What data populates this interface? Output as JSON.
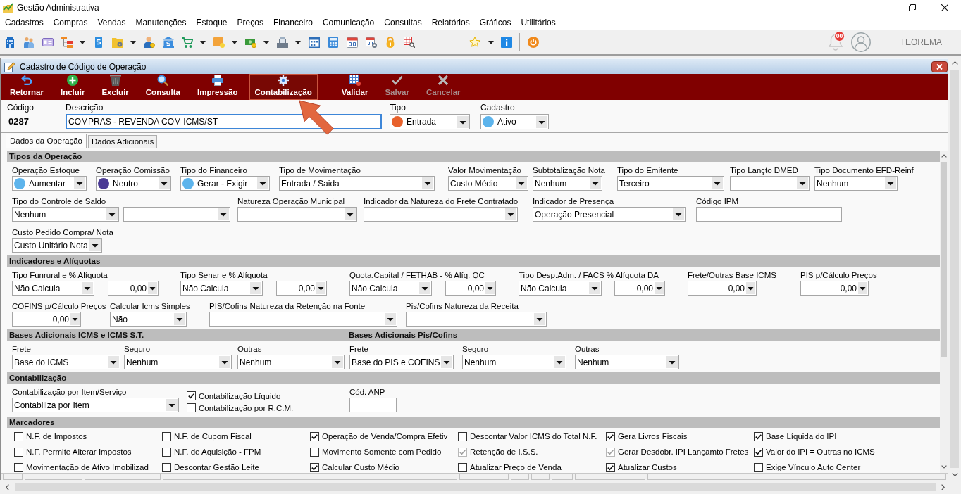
{
  "window": {
    "title": "Gestão Administrativa"
  },
  "menu": [
    "Cadastros",
    "Compras",
    "Vendas",
    "Manutenções",
    "Estoque",
    "Preços",
    "Financeiro",
    "Comunicação",
    "Consultas",
    "Relatórios",
    "Gráficos",
    "Utilitários"
  ],
  "toolbar": {
    "notification_count": "00",
    "user_name": "TEOREMA"
  },
  "child_window": {
    "title": "Cadastro de Código de Operação",
    "actions": [
      {
        "label": "Retornar",
        "highlighted": false,
        "disabled": false
      },
      {
        "label": "Incluir",
        "highlighted": false,
        "disabled": false
      },
      {
        "label": "Excluir",
        "highlighted": false,
        "disabled": false
      },
      {
        "label": "Consulta",
        "highlighted": false,
        "disabled": false
      },
      {
        "label": "Impressão",
        "highlighted": false,
        "disabled": false
      },
      {
        "label": "Contabilização",
        "highlighted": true,
        "disabled": false
      },
      {
        "label": "Validar",
        "highlighted": false,
        "disabled": false
      },
      {
        "label": "Salvar",
        "highlighted": false,
        "disabled": true
      },
      {
        "label": "Cancelar",
        "highlighted": false,
        "disabled": true
      }
    ],
    "header_fields": [
      {
        "label": "Código",
        "kind": "static",
        "value": "0287",
        "focused": false
      },
      {
        "label": "Descrição",
        "kind": "input",
        "value": "COMPRAS - REVENDA COM ICMS/ST",
        "focused": true
      },
      {
        "label": "Tipo",
        "kind": "select",
        "value": "Entrada",
        "color": "#e8622c",
        "focused": false
      },
      {
        "label": "Cadastro",
        "kind": "select",
        "value": "Ativo",
        "color": "#5db4ec",
        "focused": false
      }
    ],
    "tabs": [
      {
        "label": "Dados da Operação",
        "selected": true
      },
      {
        "label": "Dados Adicionais",
        "selected": false
      }
    ],
    "sections": [
      {
        "titles": [
          "Tipos da Operação"
        ],
        "rows": [
          {
            "fields": [
              {
                "label": "Operação Estoque",
                "kind": "select",
                "value": "Aumentar",
                "color": "#5db4ec"
              },
              {
                "label": "Operação Comissão",
                "kind": "select",
                "value": "Neutro",
                "color": "#4a3a94"
              },
              {
                "label": "Tipo do Financeiro",
                "kind": "select",
                "value": "Gerar - Exigir",
                "color": "#5db4ec"
              },
              {
                "label": "Tipo de Movimentação",
                "kind": "select",
                "value": "Entrada / Saida"
              },
              {
                "label": "Valor Movimentação",
                "kind": "select",
                "value": "Custo Médio"
              },
              {
                "label": "Subtotalização Nota",
                "kind": "select",
                "value": "Nenhum"
              },
              {
                "label": "Tipo do Emitente",
                "kind": "select",
                "value": "Terceiro"
              },
              {
                "label": "Tipo Lançto DMED",
                "kind": "select"
              },
              {
                "label": "Tipo Documento EFD-Reinf",
                "kind": "select",
                "value": "Nenhum"
              }
            ]
          },
          {
            "fields": [
              {
                "label": "Tipo do Controle de Saldo",
                "kind": "select",
                "value": "Nenhum"
              },
              {
                "kind": "select"
              },
              {
                "label": "Natureza Operação Municipal",
                "kind": "select"
              },
              {
                "label": "Indicador da Natureza do Frete Contratado",
                "kind": "select"
              },
              {
                "label": "Indicador de Presença",
                "kind": "select",
                "value": "Operação Presencial"
              },
              {
                "label": "Código IPM",
                "kind": "input"
              }
            ]
          },
          {
            "fields": [
              {
                "label": "Custo Pedido Compra/ Nota",
                "kind": "select",
                "value": "Custo Unitário Nota"
              }
            ]
          }
        ]
      },
      {
        "titles": [
          "Indicadores e Alíquotas"
        ],
        "rows": [
          {
            "fields": [
              {
                "label": "Tipo Funrural e % Alíquota",
                "kind": "select",
                "value": "Não Calcula"
              },
              {
                "kind": "number",
                "value": "0,00"
              },
              {
                "label": "Tipo Senar e % Alíquota",
                "kind": "select",
                "value": "Não Calcula"
              },
              {
                "kind": "number",
                "value": "0,00"
              },
              {
                "label": "Quota.Capital / FETHAB - % Alíq. QC",
                "kind": "select",
                "value": "Não Calcula"
              },
              {
                "kind": "number",
                "value": "0,00"
              },
              {
                "label": "Tipo Desp.Adm. / FACS % Alíquota DA",
                "kind": "select",
                "value": "Não Calcula"
              },
              {
                "kind": "number",
                "value": "0,00"
              },
              {
                "label": "Frete/Outras Base ICMS",
                "kind": "number",
                "value": "0,00"
              },
              {
                "label": "PIS p/Cálculo Preços",
                "kind": "number",
                "value": "0,00"
              }
            ]
          },
          {
            "fields": [
              {
                "label": "COFINS p/Cálculo Preços",
                "kind": "number",
                "value": "0,00"
              },
              {
                "label": "Calcular Icms Simples",
                "kind": "select",
                "value": "Não"
              },
              {
                "label": "PIS/Cofins Natureza da Retenção na Fonte",
                "kind": "select"
              },
              {
                "label": "Pis/Cofins Natureza da Receita",
                "kind": "select"
              }
            ]
          }
        ]
      },
      {
        "titles": [
          "Bases Adicionais ICMS e ICMS S.T.",
          "Bases Adicionais Pis/Cofins"
        ],
        "rows": [
          {
            "fields": [
              {
                "label": "Frete",
                "kind": "select",
                "value": "Base do ICMS"
              },
              {
                "label": "Seguro",
                "kind": "select",
                "value": "Nenhum"
              },
              {
                "label": "Outras",
                "kind": "select",
                "value": "Nenhum"
              },
              {
                "label": "Frete",
                "kind": "select",
                "value": "Base do PIS e COFINS"
              },
              {
                "label": "Seguro",
                "kind": "select",
                "value": "Nenhum"
              },
              {
                "label": "Outras",
                "kind": "select",
                "value": "Nenhum"
              }
            ]
          }
        ]
      },
      {
        "titles": [
          "Contabilização"
        ],
        "rows": [
          {
            "fields": [
              {
                "label": "Contabilização por Item/Serviço",
                "kind": "select",
                "value": "Contabiliza por Item"
              },
              {
                "kind": "checks",
                "items": [
                  {
                    "label": "Contabilização Líquido",
                    "checked": true
                  },
                  {
                    "label": "Contabilização por R.C.M.",
                    "checked": false
                  }
                ]
              },
              {
                "label": "Cód. ANP",
                "kind": "input"
              }
            ]
          }
        ]
      },
      {
        "titles": [
          "Marcadores"
        ],
        "checkboxes": [
          {
            "label": "N.F. de Impostos",
            "checked": false,
            "disabled": false
          },
          {
            "label": "N.F. de Cupom Fiscal",
            "checked": false,
            "disabled": false
          },
          {
            "label": "Operação de Venda/Compra Efetiv",
            "checked": true,
            "disabled": false
          },
          {
            "label": "Descontar Valor ICMS do Total N.F.",
            "checked": false,
            "disabled": false
          },
          {
            "label": "Gera Livros Fiscais",
            "checked": true,
            "disabled": false
          },
          {
            "label": "Base Líquida do IPI",
            "checked": true,
            "disabled": false
          },
          {
            "label": "N.F. Permite Alterar Impostos",
            "checked": false,
            "disabled": false
          },
          {
            "label": "N.F. de Aquisição - FPM",
            "checked": false,
            "disabled": false
          },
          {
            "label": "Movimento Somente com Pedido",
            "checked": false,
            "disabled": false
          },
          {
            "label": "Retenção de I.S.S.",
            "checked": true,
            "disabled": true
          },
          {
            "label": "Gerar Desdobr. IPI Lançamto Fretes",
            "checked": true,
            "disabled": true
          },
          {
            "label": "Valor do IPI = Outras no ICMS",
            "checked": true,
            "disabled": false
          },
          {
            "label": "Movimentação de Ativo Imobilizad",
            "checked": false,
            "disabled": false
          },
          {
            "label": "Descontar Gestão Leite",
            "checked": false,
            "disabled": false
          },
          {
            "label": "Calcular Custo Médio",
            "checked": true,
            "disabled": false
          },
          {
            "label": "Atualizar Preço de Venda",
            "checked": false,
            "disabled": false
          },
          {
            "label": "Atualizar Custos",
            "checked": true,
            "disabled": false
          },
          {
            "label": "Exige Vínculo Auto Center",
            "checked": false,
            "disabled": false
          }
        ]
      }
    ]
  }
}
